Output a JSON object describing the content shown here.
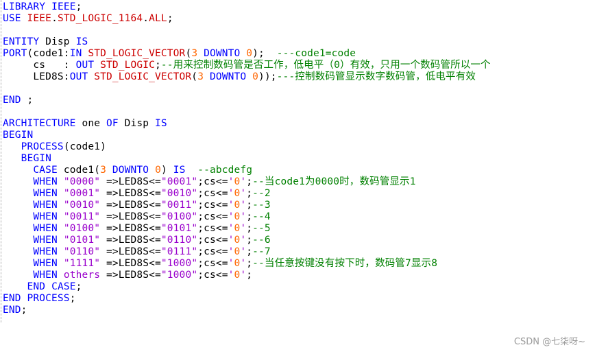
{
  "editor": {
    "lines": [
      [
        [
          "kw",
          "LIBRARY"
        ],
        [
          "pl",
          " "
        ],
        [
          "kw",
          "IEEE"
        ],
        [
          "pl",
          ";"
        ]
      ],
      [
        [
          "kw",
          "USE"
        ],
        [
          "pl",
          " "
        ],
        [
          "ty",
          "IEEE"
        ],
        [
          "pl",
          "."
        ],
        [
          "ty",
          "STD_LOGIC_1164"
        ],
        [
          "pl",
          "."
        ],
        [
          "ty",
          "ALL"
        ],
        [
          "pl",
          ";"
        ]
      ],
      [],
      [
        [
          "kw",
          "ENTITY"
        ],
        [
          "pl",
          " Disp "
        ],
        [
          "kw",
          "IS"
        ]
      ],
      [
        [
          "kw",
          "PORT"
        ],
        [
          "pl",
          "(code1:"
        ],
        [
          "kw",
          "IN"
        ],
        [
          "pl",
          " "
        ],
        [
          "ty",
          "STD_LOGIC_VECTOR"
        ],
        [
          "pl",
          "("
        ],
        [
          "num",
          "3"
        ],
        [
          "pl",
          " "
        ],
        [
          "kw",
          "DOWNTO"
        ],
        [
          "pl",
          " "
        ],
        [
          "num",
          "0"
        ],
        [
          "pl",
          ");  "
        ],
        [
          "cm",
          "---code1=code"
        ]
      ],
      [
        [
          "pl",
          "     cs   : "
        ],
        [
          "kw",
          "OUT"
        ],
        [
          "pl",
          " "
        ],
        [
          "ty",
          "STD_LOGIC"
        ],
        [
          "pl",
          ";"
        ],
        [
          "cm",
          "--用来控制数码管是否工作，低电平（0）有效，只用一个数码管所以一个"
        ]
      ],
      [
        [
          "pl",
          "     LED8S:"
        ],
        [
          "kw",
          "OUT"
        ],
        [
          "pl",
          " "
        ],
        [
          "ty",
          "STD_LOGIC_VECTOR"
        ],
        [
          "pl",
          "("
        ],
        [
          "num",
          "3"
        ],
        [
          "pl",
          " "
        ],
        [
          "kw",
          "DOWNTO"
        ],
        [
          "pl",
          " "
        ],
        [
          "num",
          "0"
        ],
        [
          "pl",
          "));"
        ],
        [
          "cm",
          "---控制数码管显示数字数码管，低电平有效"
        ]
      ],
      [],
      [
        [
          "kw",
          "END"
        ],
        [
          "pl",
          " ;"
        ]
      ],
      [],
      [
        [
          "kw",
          "ARCHITECTURE"
        ],
        [
          "pl",
          " one "
        ],
        [
          "kw",
          "OF"
        ],
        [
          "pl",
          " Disp "
        ],
        [
          "kw",
          "IS"
        ]
      ],
      [
        [
          "kw",
          "BEGIN"
        ]
      ],
      [
        [
          "pl",
          "   "
        ],
        [
          "kw",
          "PROCESS"
        ],
        [
          "pl",
          "(code1)"
        ]
      ],
      [
        [
          "pl",
          "   "
        ],
        [
          "kw",
          "BEGIN"
        ]
      ],
      [
        [
          "pl",
          "     "
        ],
        [
          "kw",
          "CASE"
        ],
        [
          "pl",
          " code1("
        ],
        [
          "num",
          "3"
        ],
        [
          "pl",
          " "
        ],
        [
          "kw",
          "DOWNTO"
        ],
        [
          "pl",
          " "
        ],
        [
          "num",
          "0"
        ],
        [
          "pl",
          ") "
        ],
        [
          "kw",
          "IS"
        ],
        [
          "pl",
          "  "
        ],
        [
          "cm",
          "--abcdefg"
        ]
      ],
      [
        [
          "pl",
          "     "
        ],
        [
          "kw",
          "WHEN"
        ],
        [
          "pl",
          " "
        ],
        [
          "str",
          "\"0000\""
        ],
        [
          "pl",
          " =>LED8S<="
        ],
        [
          "str",
          "\"0001\""
        ],
        [
          "pl",
          ";cs<="
        ],
        [
          "str",
          "'"
        ],
        [
          "num",
          "0"
        ],
        [
          "str",
          "'"
        ],
        [
          "pl",
          ";"
        ],
        [
          "cm",
          "--当code1为0000时，数码管显示1"
        ]
      ],
      [
        [
          "pl",
          "     "
        ],
        [
          "kw",
          "WHEN"
        ],
        [
          "pl",
          " "
        ],
        [
          "str",
          "\"0001\""
        ],
        [
          "pl",
          " =>LED8S<="
        ],
        [
          "str",
          "\"0010\""
        ],
        [
          "pl",
          ";cs<="
        ],
        [
          "str",
          "'"
        ],
        [
          "num",
          "0"
        ],
        [
          "str",
          "'"
        ],
        [
          "pl",
          ";"
        ],
        [
          "cm",
          "--2"
        ]
      ],
      [
        [
          "pl",
          "     "
        ],
        [
          "kw",
          "WHEN"
        ],
        [
          "pl",
          " "
        ],
        [
          "str",
          "\"0010\""
        ],
        [
          "pl",
          " =>LED8S<="
        ],
        [
          "str",
          "\"0011\""
        ],
        [
          "pl",
          ";cs<="
        ],
        [
          "str",
          "'"
        ],
        [
          "num",
          "0"
        ],
        [
          "str",
          "'"
        ],
        [
          "pl",
          ";"
        ],
        [
          "cm",
          "--3"
        ]
      ],
      [
        [
          "pl",
          "     "
        ],
        [
          "kw",
          "WHEN"
        ],
        [
          "pl",
          " "
        ],
        [
          "str",
          "\"0011\""
        ],
        [
          "pl",
          " =>LED8S<="
        ],
        [
          "str",
          "\"0100\""
        ],
        [
          "pl",
          ";cs<="
        ],
        [
          "str",
          "'"
        ],
        [
          "num",
          "0"
        ],
        [
          "str",
          "'"
        ],
        [
          "pl",
          ";"
        ],
        [
          "cm",
          "--4"
        ]
      ],
      [
        [
          "pl",
          "     "
        ],
        [
          "kw",
          "WHEN"
        ],
        [
          "pl",
          " "
        ],
        [
          "str",
          "\"0100\""
        ],
        [
          "pl",
          " =>LED8S<="
        ],
        [
          "str",
          "\"0101\""
        ],
        [
          "pl",
          ";cs<="
        ],
        [
          "str",
          "'"
        ],
        [
          "num",
          "0"
        ],
        [
          "str",
          "'"
        ],
        [
          "pl",
          ";"
        ],
        [
          "cm",
          "--5"
        ]
      ],
      [
        [
          "pl",
          "     "
        ],
        [
          "kw",
          "WHEN"
        ],
        [
          "pl",
          " "
        ],
        [
          "str",
          "\"0101\""
        ],
        [
          "pl",
          " =>LED8S<="
        ],
        [
          "str",
          "\"0110\""
        ],
        [
          "pl",
          ";cs<="
        ],
        [
          "str",
          "'"
        ],
        [
          "num",
          "0"
        ],
        [
          "str",
          "'"
        ],
        [
          "pl",
          ";"
        ],
        [
          "cm",
          "--6"
        ]
      ],
      [
        [
          "pl",
          "     "
        ],
        [
          "kw",
          "WHEN"
        ],
        [
          "pl",
          " "
        ],
        [
          "str",
          "\"0110\""
        ],
        [
          "pl",
          " =>LED8S<="
        ],
        [
          "str",
          "\"0111\""
        ],
        [
          "pl",
          ";cs<="
        ],
        [
          "str",
          "'"
        ],
        [
          "num",
          "0"
        ],
        [
          "str",
          "'"
        ],
        [
          "pl",
          ";"
        ],
        [
          "cm",
          "--7"
        ]
      ],
      [
        [
          "pl",
          "     "
        ],
        [
          "kw",
          "WHEN"
        ],
        [
          "pl",
          " "
        ],
        [
          "str",
          "\"1111\""
        ],
        [
          "pl",
          " =>LED8S<="
        ],
        [
          "str",
          "\"1000\""
        ],
        [
          "pl",
          ";cs<="
        ],
        [
          "str",
          "'"
        ],
        [
          "num",
          "0"
        ],
        [
          "str",
          "'"
        ],
        [
          "pl",
          ";"
        ],
        [
          "cm",
          "--当任意按键没有按下时，数码管7显示8"
        ]
      ],
      [
        [
          "pl",
          "     "
        ],
        [
          "kw",
          "WHEN"
        ],
        [
          "pl",
          " "
        ],
        [
          "str",
          "others"
        ],
        [
          "pl",
          " =>LED8S<="
        ],
        [
          "str",
          "\"1000\""
        ],
        [
          "pl",
          ";cs<="
        ],
        [
          "str",
          "'"
        ],
        [
          "num",
          "0"
        ],
        [
          "str",
          "'"
        ],
        [
          "pl",
          ";"
        ]
      ],
      [
        [
          "pl",
          "    "
        ],
        [
          "kw",
          "END"
        ],
        [
          "pl",
          " "
        ],
        [
          "kw",
          "CASE"
        ],
        [
          "pl",
          ";"
        ]
      ],
      [
        [
          "kw",
          "END"
        ],
        [
          "pl",
          " "
        ],
        [
          "kw",
          "PROCESS"
        ],
        [
          "pl",
          ";"
        ]
      ],
      [
        [
          "kw",
          "END"
        ],
        [
          "pl",
          ";"
        ]
      ]
    ]
  },
  "watermark": "CSDN @七柒呀~",
  "colors": {
    "keyword": "#0000ff",
    "type": "#cc0000",
    "number": "#ff6600",
    "string": "#9900cc",
    "comment": "#008000",
    "plain": "#000000",
    "background": "#ffffff"
  }
}
